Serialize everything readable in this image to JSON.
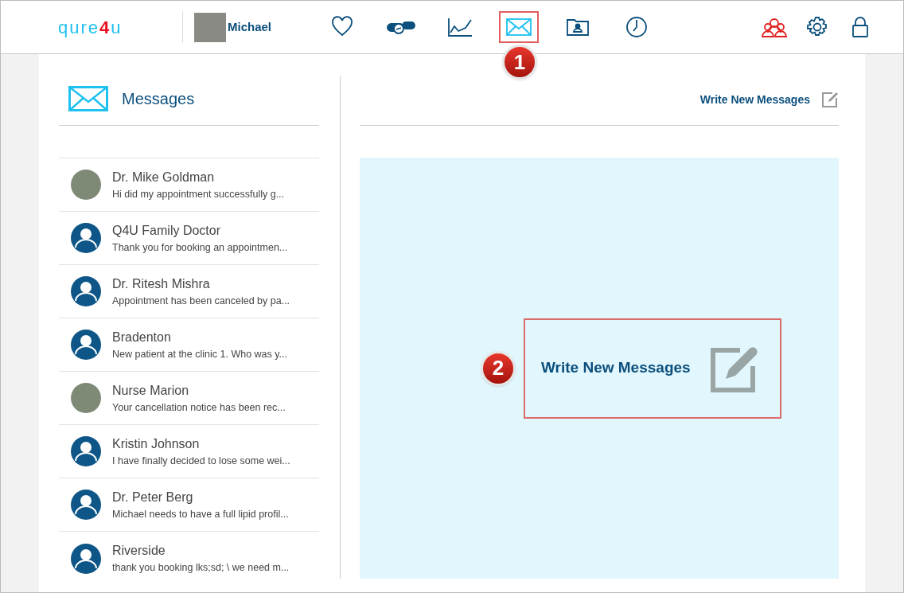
{
  "logo": {
    "parts": [
      "qure",
      "4",
      "u"
    ]
  },
  "user": {
    "name": "Michael"
  },
  "nav": [
    {
      "kind": "heart",
      "selected": false
    },
    {
      "kind": "pills",
      "selected": false
    },
    {
      "kind": "chart",
      "selected": false
    },
    {
      "kind": "mail",
      "selected": true,
      "callout": "1"
    },
    {
      "kind": "folder",
      "selected": false
    },
    {
      "kind": "clock",
      "selected": false
    }
  ],
  "nav_right": [
    {
      "kind": "group"
    },
    {
      "kind": "gear"
    },
    {
      "kind": "lock"
    }
  ],
  "messages": {
    "title": "Messages",
    "write_link": "Write New Messages",
    "contacts": [
      {
        "name": "Dr. Mike Goldman",
        "preview": "Hi did my appointment successfully g...",
        "kind": "photo"
      },
      {
        "name": "Q4U Family Doctor",
        "preview": "Thank you for booking an appointmen...",
        "kind": "default"
      },
      {
        "name": "Dr. Ritesh Mishra",
        "preview": "Appointment has been canceled by pa...",
        "kind": "default"
      },
      {
        "name": "Bradenton",
        "preview": "New patient at the clinic 1. Who was y...",
        "kind": "default"
      },
      {
        "name": "Nurse Marion",
        "preview": "Your cancellation notice has been rec...",
        "kind": "photo"
      },
      {
        "name": "Kristin Johnson",
        "preview": "I have finally decided to lose some wei...",
        "kind": "default"
      },
      {
        "name": "Dr. Peter Berg",
        "preview": "Michael needs to have a full lipid profil...",
        "kind": "default"
      },
      {
        "name": "Riverside",
        "preview": "thank you booking lks;sd; \\ we need m...",
        "kind": "default"
      }
    ],
    "compose": {
      "label": "Write New Messages",
      "callout": "2"
    }
  }
}
